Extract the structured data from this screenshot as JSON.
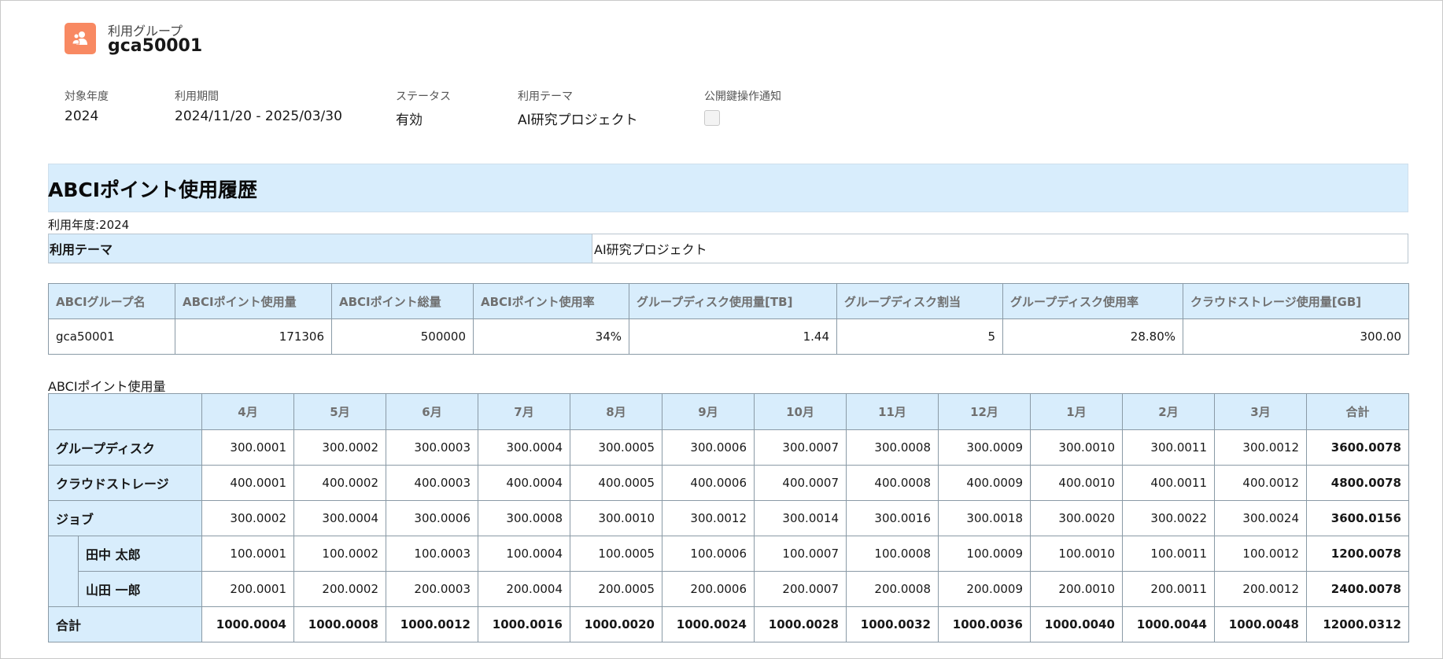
{
  "header": {
    "object_type": "利用グループ",
    "object_name": "gca50001",
    "icon": "group-icon",
    "icon_color": "#f88962"
  },
  "fields": {
    "fiscal_year": {
      "label": "対象年度",
      "value": "2024"
    },
    "period": {
      "label": "利用期間",
      "value": "2024/11/20 - 2025/03/30"
    },
    "status": {
      "label": "ステータス",
      "value": "有効"
    },
    "theme": {
      "label": "利用テーマ",
      "value": "AI研究プロジェクト"
    },
    "public_key_notice": {
      "label": "公開鍵操作通知",
      "checked": false
    }
  },
  "history": {
    "title": "ABCIポイント使用履歴",
    "year_line": "利用年度:2024",
    "theme_label": "利用テーマ",
    "theme_value": "AI研究プロジェクト",
    "summary": {
      "headers": [
        "ABCIグループ名",
        "ABCIポイント使用量",
        "ABCIポイント総量",
        "ABCIポイント使用率",
        "グループディスク使用量[TB]",
        "グループディスク割当",
        "グループディスク使用率",
        "クラウドストレージ使用量[GB]"
      ],
      "row": [
        "gca50001",
        "171306",
        "500000",
        "34%",
        "1.44",
        "5",
        "28.80%",
        "300.00"
      ]
    },
    "usage_caption": "ABCIポイント使用量",
    "usage": {
      "months": [
        "4月",
        "5月",
        "6月",
        "7月",
        "8月",
        "9月",
        "10月",
        "11月",
        "12月",
        "1月",
        "2月",
        "3月",
        "合計"
      ],
      "rows": {
        "disk": {
          "label": "グループディスク",
          "values": [
            "300.0001",
            "300.0002",
            "300.0003",
            "300.0004",
            "300.0005",
            "300.0006",
            "300.0007",
            "300.0008",
            "300.0009",
            "300.0010",
            "300.0011",
            "300.0012",
            "3600.0078"
          ]
        },
        "cloud": {
          "label": "クラウドストレージ",
          "values": [
            "400.0001",
            "400.0002",
            "400.0003",
            "400.0004",
            "400.0005",
            "400.0006",
            "400.0007",
            "400.0008",
            "400.0009",
            "400.0010",
            "400.0011",
            "400.0012",
            "4800.0078"
          ]
        },
        "job": {
          "label": "ジョブ",
          "values": [
            "300.0002",
            "300.0004",
            "300.0006",
            "300.0008",
            "300.0010",
            "300.0012",
            "300.0014",
            "300.0016",
            "300.0018",
            "300.0020",
            "300.0022",
            "300.0024",
            "3600.0156"
          ]
        },
        "tanaka": {
          "label": "田中 太郎",
          "values": [
            "100.0001",
            "100.0002",
            "100.0003",
            "100.0004",
            "100.0005",
            "100.0006",
            "100.0007",
            "100.0008",
            "100.0009",
            "100.0010",
            "100.0011",
            "100.0012",
            "1200.0078"
          ]
        },
        "yamada": {
          "label": "山田 一郎",
          "values": [
            "200.0001",
            "200.0002",
            "200.0003",
            "200.0004",
            "200.0005",
            "200.0006",
            "200.0007",
            "200.0008",
            "200.0009",
            "200.0010",
            "200.0011",
            "200.0012",
            "2400.0078"
          ]
        },
        "total": {
          "label": "合計",
          "values": [
            "1000.0004",
            "1000.0008",
            "1000.0012",
            "1000.0016",
            "1000.0020",
            "1000.0024",
            "1000.0028",
            "1000.0032",
            "1000.0036",
            "1000.0040",
            "1000.0044",
            "1000.0048",
            "12000.0312"
          ]
        }
      }
    }
  }
}
